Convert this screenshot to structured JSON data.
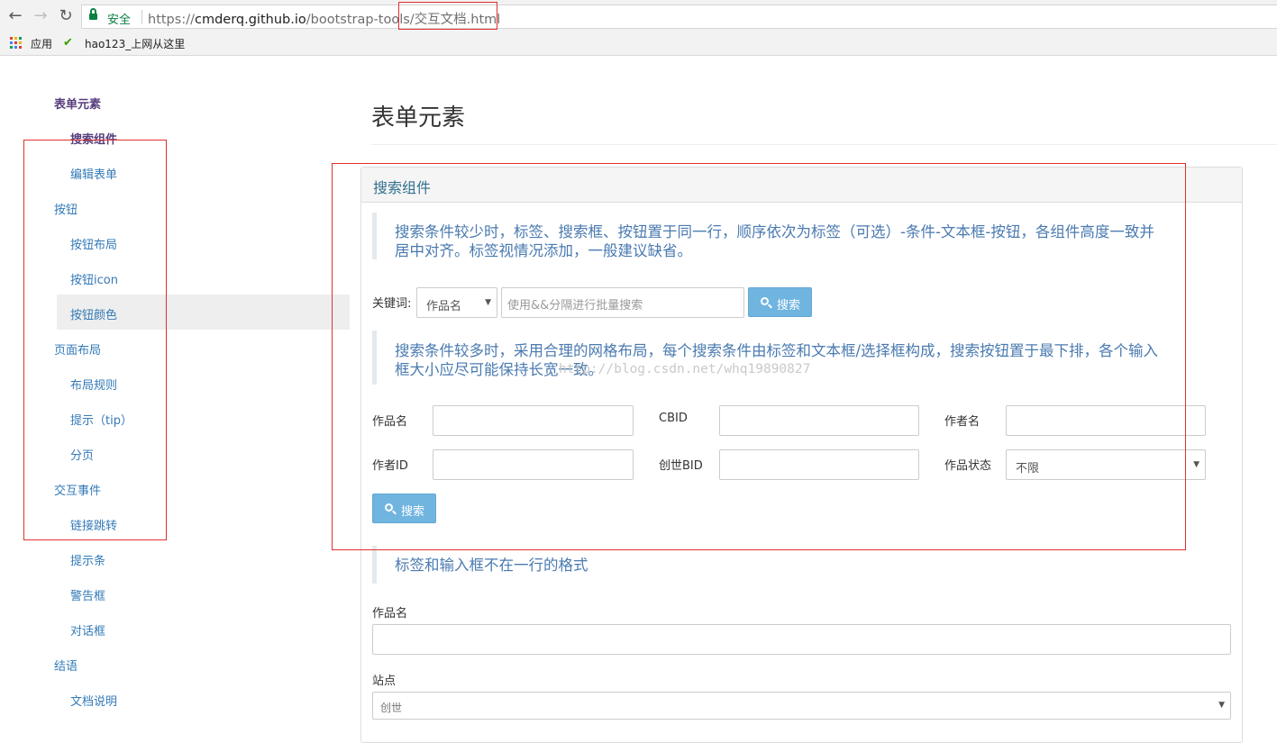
{
  "browser": {
    "back": "←",
    "forward": "→",
    "reload": "↻",
    "secure_label": "安全",
    "url_scheme": "https://",
    "url_host": "cmderq.github.io",
    "url_path": "/bootstrap-tools/",
    "url_file": "交互文档.html",
    "bookmarks": [
      {
        "label": "应用",
        "icon": "apps-grid-icon"
      },
      {
        "label": "hao123_上网从这里",
        "icon": "hao123-icon"
      }
    ]
  },
  "sidebar": {
    "items": [
      {
        "label": "表单元素",
        "level": 1,
        "active": true
      },
      {
        "label": "搜索组件",
        "level": 2,
        "active": true
      },
      {
        "label": "编辑表单",
        "level": 2
      },
      {
        "label": "按钮",
        "level": 1
      },
      {
        "label": "按钮布局",
        "level": 2
      },
      {
        "label": "按钮icon",
        "level": 2
      },
      {
        "label": "按钮颜色",
        "level": 2,
        "hovered": true
      },
      {
        "label": "页面布局",
        "level": 1
      },
      {
        "label": "布局规则",
        "level": 2
      },
      {
        "label": "提示（tip）",
        "level": 2
      },
      {
        "label": "分页",
        "level": 2
      },
      {
        "label": "交互事件",
        "level": 1
      },
      {
        "label": "链接跳转",
        "level": 2
      },
      {
        "label": "提示条",
        "level": 2
      },
      {
        "label": "警告框",
        "level": 2
      },
      {
        "label": "对话框",
        "level": 2
      },
      {
        "label": "结语",
        "level": 1
      },
      {
        "label": "文档说明",
        "level": 2
      }
    ]
  },
  "main": {
    "page_title": "表单元素",
    "panel_title": "搜索组件",
    "quote1_line1": "搜索条件较少时，标签、搜索框、按钮置于同一行，顺序依次为标签（可选）-条件-文本框-按钮，各组件高度一致并",
    "quote1_line2": "居中对齐。标签视情况添加，一般建议缺省。",
    "simple_search": {
      "label": "关键词:",
      "select_value": "作品名",
      "input_placeholder": "使用&&分隔进行批量搜索",
      "button_label": "搜索"
    },
    "quote2_line1": "搜索条件较多时，采用合理的网格布局，每个搜索条件由标签和文本框/选择框构成，搜索按钮置于最下排，各个输入",
    "quote2_line2": "框大小应尽可能保持长宽一致。",
    "watermark": "http://blog.csdn.net/whq19890827",
    "grid_search": {
      "fields": [
        {
          "label": "作品名"
        },
        {
          "label": "CBID"
        },
        {
          "label": "作者名"
        },
        {
          "label": "作者ID"
        },
        {
          "label": "创世BID"
        },
        {
          "label": "作品状态",
          "select_value": "不限"
        }
      ],
      "button_label": "搜索"
    },
    "quote3": "标签和输入框不在一行的格式",
    "stacked": {
      "field1_label": "作品名",
      "field2_label": "站点",
      "field2_value": "创世"
    }
  },
  "colors": {
    "link": "#337ab7",
    "active": "#563d7c",
    "annotation": "#e03030",
    "button": "#70b4e0",
    "panel_title": "#31708f"
  }
}
